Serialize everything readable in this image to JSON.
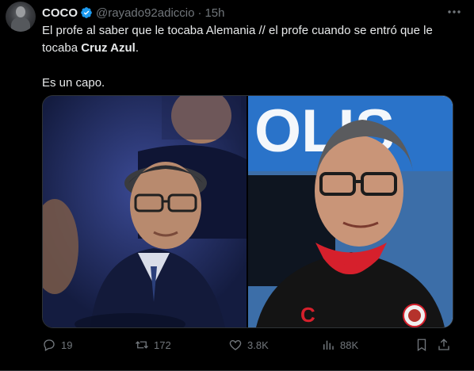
{
  "author": {
    "name": "COCO",
    "handle": "@rayado92adiccio",
    "separator": "·",
    "time": "15h"
  },
  "tweet": {
    "line1_part1": "El profe al saber que le tocaba Alemania // el profe cuando se entró que le tocaba ",
    "line1_bold": "Cruz Azul",
    "line1_end": ".",
    "line2": "Es un capo."
  },
  "media": {
    "left_image": "man-with-glasses-suit-photo",
    "right_image": "man-with-glasses-jersey-photo"
  },
  "actions": {
    "replies": "19",
    "reposts": "172",
    "likes": "3.8K",
    "views": "88K"
  },
  "colors": {
    "background": "#000000",
    "text": "#e7e9ea",
    "muted": "#71767b",
    "verified": "#1d9bf0",
    "jersey_red": "#d6202c"
  }
}
